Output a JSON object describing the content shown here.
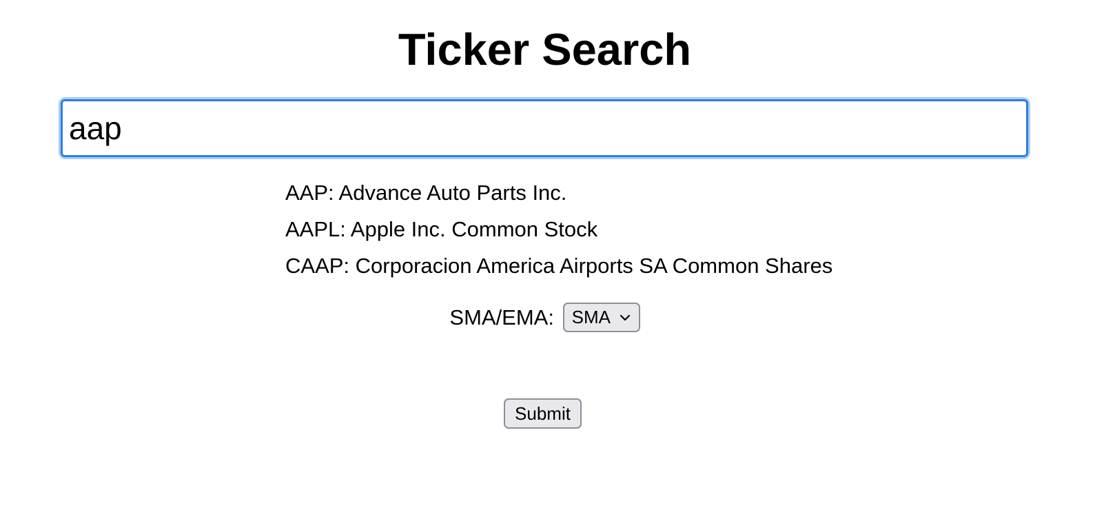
{
  "page": {
    "title": "Ticker Search"
  },
  "search": {
    "value": "aap",
    "focus_color": "#2f7de6"
  },
  "suggestions": [
    {
      "label": "AAP: Advance Auto Parts Inc."
    },
    {
      "label": "AAPL: Apple Inc. Common Stock"
    },
    {
      "label": "CAAP: Corporacion America Airports SA Common Shares"
    }
  ],
  "moving_average": {
    "label": "SMA/EMA:",
    "selected": "SMA",
    "icon": "chevron-down-icon"
  },
  "form": {
    "submit_label": "Submit"
  }
}
